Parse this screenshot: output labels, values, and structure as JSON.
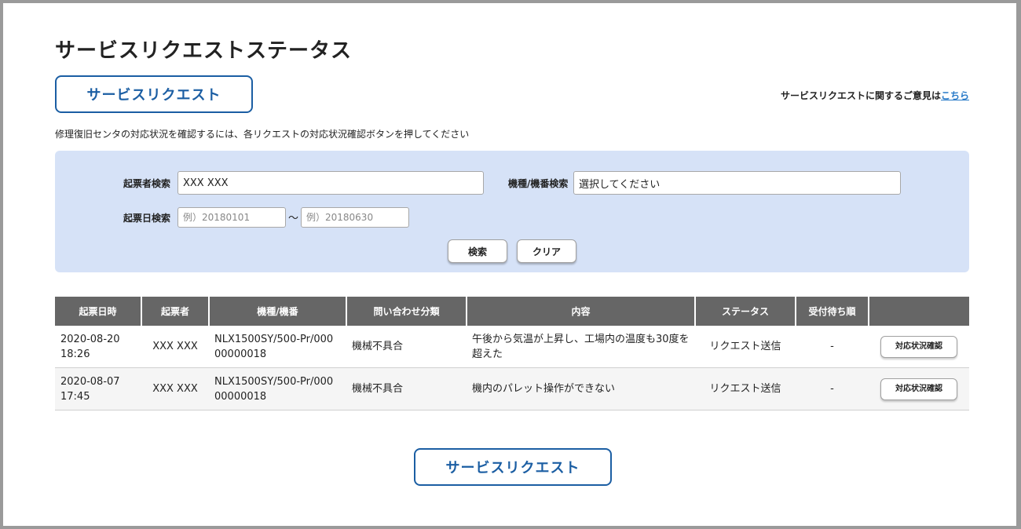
{
  "page": {
    "title": "サービスリクエストステータス",
    "service_request_button": "サービスリクエスト",
    "feedback_text": "サービスリクエストに関するご意見は",
    "feedback_link": "こちら",
    "instruction": "修理復旧センタの対応状況を確認するには、各リクエストの対応状況確認ボタンを押してください"
  },
  "search": {
    "requester_label": "起票者検索",
    "requester_value": "XXX XXX",
    "model_label": "機種/機番検索",
    "model_value": "選択してください",
    "date_label": "起票日検索",
    "date_from_placeholder": "例）20180101",
    "date_sep": "〜",
    "date_to_placeholder": "例）20180630",
    "search_button": "検索",
    "clear_button": "クリア"
  },
  "table": {
    "headers": [
      "起票日時",
      "起票者",
      "機種/機番",
      "問い合わせ分類",
      "内容",
      "ステータス",
      "受付待ち順",
      ""
    ],
    "action_label": "対応状況確認",
    "rows": [
      {
        "date": "2020-08-20",
        "time": "18:26",
        "requester": "XXX XXX",
        "model": "NLX1500SY/500-Pr/000",
        "serial": "00000018",
        "category": "機械不具合",
        "content": "午後から気温が上昇し、工場内の温度も30度を超えた",
        "status": "リクエスト送信",
        "queue": "-"
      },
      {
        "date": "2020-08-07",
        "time": "17:45",
        "requester": "XXX XXX",
        "model": "NLX1500SY/500-Pr/000",
        "serial": "00000018",
        "category": "機械不具合",
        "content": "機内のパレット操作ができない",
        "status": "リクエスト送信",
        "queue": "-"
      }
    ]
  }
}
